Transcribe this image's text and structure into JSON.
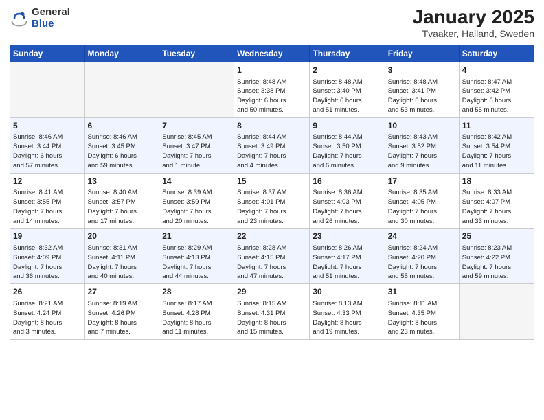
{
  "header": {
    "logo_general": "General",
    "logo_blue": "Blue",
    "month_title": "January 2025",
    "location": "Tvaaker, Halland, Sweden"
  },
  "days_of_week": [
    "Sunday",
    "Monday",
    "Tuesday",
    "Wednesday",
    "Thursday",
    "Friday",
    "Saturday"
  ],
  "weeks": [
    {
      "row_class": "row-white",
      "days": [
        {
          "num": "",
          "info": "",
          "empty": true
        },
        {
          "num": "",
          "info": "",
          "empty": true
        },
        {
          "num": "",
          "info": "",
          "empty": true
        },
        {
          "num": "1",
          "info": "Sunrise: 8:48 AM\nSunset: 3:38 PM\nDaylight: 6 hours\nand 50 minutes.",
          "empty": false
        },
        {
          "num": "2",
          "info": "Sunrise: 8:48 AM\nSunset: 3:40 PM\nDaylight: 6 hours\nand 51 minutes.",
          "empty": false
        },
        {
          "num": "3",
          "info": "Sunrise: 8:48 AM\nSunset: 3:41 PM\nDaylight: 6 hours\nand 53 minutes.",
          "empty": false
        },
        {
          "num": "4",
          "info": "Sunrise: 8:47 AM\nSunset: 3:42 PM\nDaylight: 6 hours\nand 55 minutes.",
          "empty": false
        }
      ]
    },
    {
      "row_class": "row-blue",
      "days": [
        {
          "num": "5",
          "info": "Sunrise: 8:46 AM\nSunset: 3:44 PM\nDaylight: 6 hours\nand 57 minutes.",
          "empty": false
        },
        {
          "num": "6",
          "info": "Sunrise: 8:46 AM\nSunset: 3:45 PM\nDaylight: 6 hours\nand 59 minutes.",
          "empty": false
        },
        {
          "num": "7",
          "info": "Sunrise: 8:45 AM\nSunset: 3:47 PM\nDaylight: 7 hours\nand 1 minute.",
          "empty": false
        },
        {
          "num": "8",
          "info": "Sunrise: 8:44 AM\nSunset: 3:49 PM\nDaylight: 7 hours\nand 4 minutes.",
          "empty": false
        },
        {
          "num": "9",
          "info": "Sunrise: 8:44 AM\nSunset: 3:50 PM\nDaylight: 7 hours\nand 6 minutes.",
          "empty": false
        },
        {
          "num": "10",
          "info": "Sunrise: 8:43 AM\nSunset: 3:52 PM\nDaylight: 7 hours\nand 9 minutes.",
          "empty": false
        },
        {
          "num": "11",
          "info": "Sunrise: 8:42 AM\nSunset: 3:54 PM\nDaylight: 7 hours\nand 11 minutes.",
          "empty": false
        }
      ]
    },
    {
      "row_class": "row-white",
      "days": [
        {
          "num": "12",
          "info": "Sunrise: 8:41 AM\nSunset: 3:55 PM\nDaylight: 7 hours\nand 14 minutes.",
          "empty": false
        },
        {
          "num": "13",
          "info": "Sunrise: 8:40 AM\nSunset: 3:57 PM\nDaylight: 7 hours\nand 17 minutes.",
          "empty": false
        },
        {
          "num": "14",
          "info": "Sunrise: 8:39 AM\nSunset: 3:59 PM\nDaylight: 7 hours\nand 20 minutes.",
          "empty": false
        },
        {
          "num": "15",
          "info": "Sunrise: 8:37 AM\nSunset: 4:01 PM\nDaylight: 7 hours\nand 23 minutes.",
          "empty": false
        },
        {
          "num": "16",
          "info": "Sunrise: 8:36 AM\nSunset: 4:03 PM\nDaylight: 7 hours\nand 26 minutes.",
          "empty": false
        },
        {
          "num": "17",
          "info": "Sunrise: 8:35 AM\nSunset: 4:05 PM\nDaylight: 7 hours\nand 30 minutes.",
          "empty": false
        },
        {
          "num": "18",
          "info": "Sunrise: 8:33 AM\nSunset: 4:07 PM\nDaylight: 7 hours\nand 33 minutes.",
          "empty": false
        }
      ]
    },
    {
      "row_class": "row-blue",
      "days": [
        {
          "num": "19",
          "info": "Sunrise: 8:32 AM\nSunset: 4:09 PM\nDaylight: 7 hours\nand 36 minutes.",
          "empty": false
        },
        {
          "num": "20",
          "info": "Sunrise: 8:31 AM\nSunset: 4:11 PM\nDaylight: 7 hours\nand 40 minutes.",
          "empty": false
        },
        {
          "num": "21",
          "info": "Sunrise: 8:29 AM\nSunset: 4:13 PM\nDaylight: 7 hours\nand 44 minutes.",
          "empty": false
        },
        {
          "num": "22",
          "info": "Sunrise: 8:28 AM\nSunset: 4:15 PM\nDaylight: 7 hours\nand 47 minutes.",
          "empty": false
        },
        {
          "num": "23",
          "info": "Sunrise: 8:26 AM\nSunset: 4:17 PM\nDaylight: 7 hours\nand 51 minutes.",
          "empty": false
        },
        {
          "num": "24",
          "info": "Sunrise: 8:24 AM\nSunset: 4:20 PM\nDaylight: 7 hours\nand 55 minutes.",
          "empty": false
        },
        {
          "num": "25",
          "info": "Sunrise: 8:23 AM\nSunset: 4:22 PM\nDaylight: 7 hours\nand 59 minutes.",
          "empty": false
        }
      ]
    },
    {
      "row_class": "row-white",
      "days": [
        {
          "num": "26",
          "info": "Sunrise: 8:21 AM\nSunset: 4:24 PM\nDaylight: 8 hours\nand 3 minutes.",
          "empty": false
        },
        {
          "num": "27",
          "info": "Sunrise: 8:19 AM\nSunset: 4:26 PM\nDaylight: 8 hours\nand 7 minutes.",
          "empty": false
        },
        {
          "num": "28",
          "info": "Sunrise: 8:17 AM\nSunset: 4:28 PM\nDaylight: 8 hours\nand 11 minutes.",
          "empty": false
        },
        {
          "num": "29",
          "info": "Sunrise: 8:15 AM\nSunset: 4:31 PM\nDaylight: 8 hours\nand 15 minutes.",
          "empty": false
        },
        {
          "num": "30",
          "info": "Sunrise: 8:13 AM\nSunset: 4:33 PM\nDaylight: 8 hours\nand 19 minutes.",
          "empty": false
        },
        {
          "num": "31",
          "info": "Sunrise: 8:11 AM\nSunset: 4:35 PM\nDaylight: 8 hours\nand 23 minutes.",
          "empty": false
        },
        {
          "num": "",
          "info": "",
          "empty": true
        }
      ]
    }
  ]
}
